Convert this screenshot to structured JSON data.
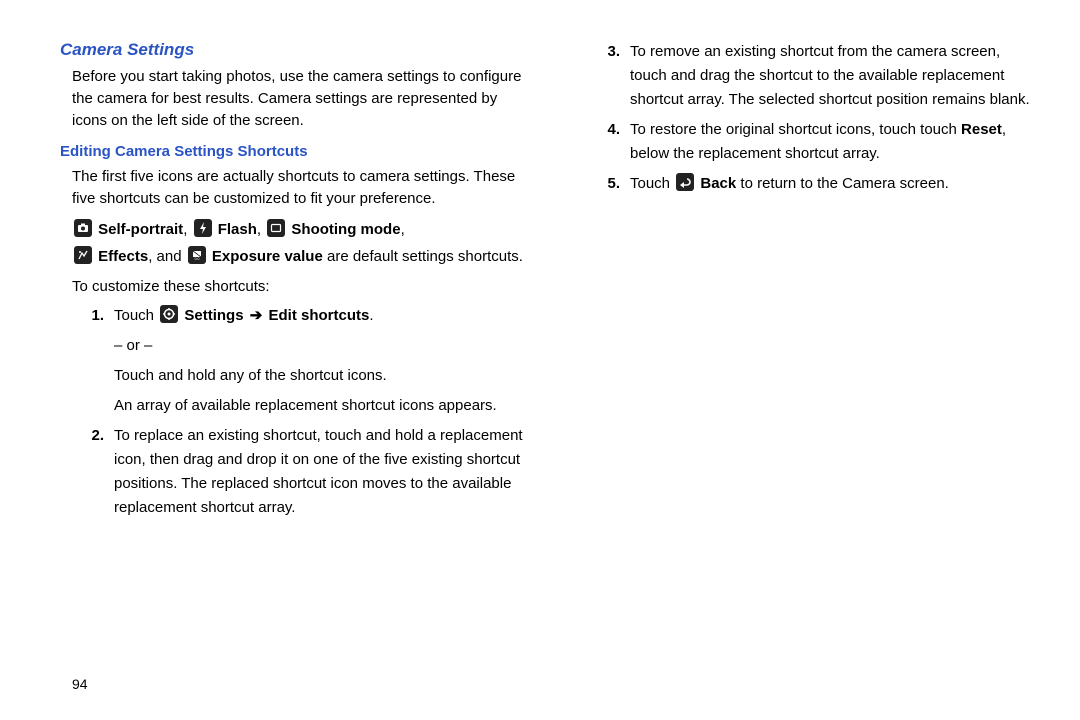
{
  "leftColumn": {
    "heading1": "Camera Settings",
    "para1": "Before you start taking photos, use the camera settings to configure the camera for best results. Camera settings are represented by icons on the left side of the screen.",
    "heading2": "Editing Camera Settings Shortcuts",
    "para2": "The first five icons are actually shortcuts to camera settings. These five shortcuts can be customized to fit your preference.",
    "defaults": {
      "selfPortrait": "Self-portrait",
      "flash": "Flash",
      "shootingMode": "Shooting mode",
      "effects": "Effects",
      "and": ", and",
      "exposure": "Exposure value",
      "tail": " are default settings shortcuts."
    },
    "customizeIntro": "To customize these shortcuts:",
    "step1": {
      "num": "1.",
      "pre": "Touch ",
      "settings": "Settings",
      "arrow": "➔",
      "edit": "Edit shortcuts",
      "after": ".",
      "or": "– or –",
      "holdLine": "Touch and hold any of the shortcut icons.",
      "arrayLine": "An array of available replacement shortcut icons appears."
    },
    "step2": {
      "num": "2.",
      "text": "To replace an existing shortcut, touch and hold a replacement icon, then drag and drop it on one of the five existing shortcut positions. The replaced shortcut icon moves to the available replacement shortcut array."
    }
  },
  "rightColumn": {
    "step3": {
      "num": "3.",
      "text": "To remove an existing shortcut from the camera screen, touch and drag the shortcut to the available replacement shortcut array. The selected shortcut position remains blank."
    },
    "step4": {
      "num": "4.",
      "pre": "To restore the original shortcut icons, touch touch ",
      "reset": "Reset",
      "after": ", below the replacement shortcut array."
    },
    "step5": {
      "num": "5.",
      "pre": "Touch ",
      "back": "Back",
      "after": " to return to the Camera screen."
    }
  },
  "pageNumber": "94"
}
